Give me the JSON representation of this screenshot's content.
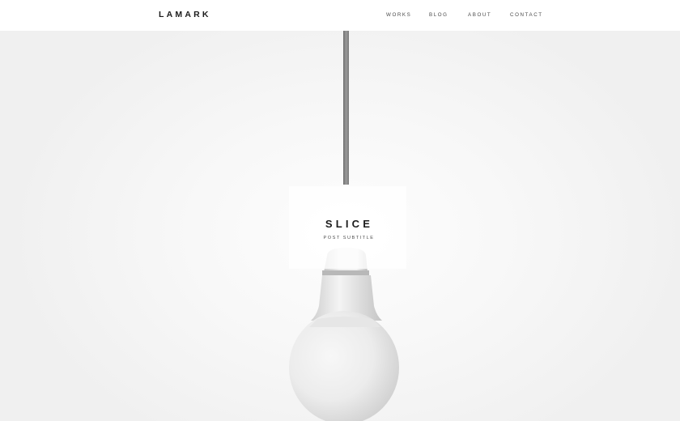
{
  "header": {
    "logo": "LAMARK",
    "nav": [
      "WORKS",
      "BLOG",
      "ABOUT",
      "CONTACT"
    ]
  },
  "hero": {
    "title": "SLICE",
    "subtitle": "POST SUBTITLE",
    "image": "pendant-light-bulb"
  }
}
